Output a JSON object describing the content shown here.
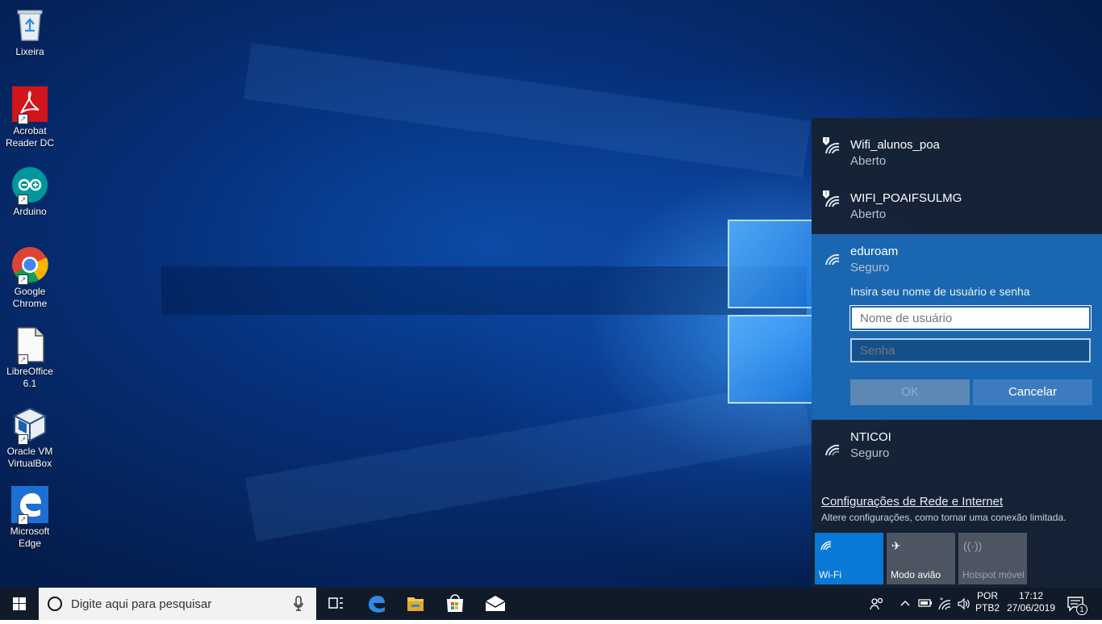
{
  "desktop": {
    "icons": [
      {
        "label": "Lixeira",
        "icon": "recycle-bin-icon"
      },
      {
        "label": "Acrobat Reader DC",
        "icon": "acrobat-icon"
      },
      {
        "label": "Arduino",
        "icon": "arduino-icon"
      },
      {
        "label": "Google Chrome",
        "icon": "chrome-icon"
      },
      {
        "label": "LibreOffice 6.1",
        "icon": "libreoffice-icon"
      },
      {
        "label": "Oracle VM VirtualBox",
        "icon": "virtualbox-icon"
      },
      {
        "label": "Microsoft Edge",
        "icon": "edge-icon"
      }
    ]
  },
  "network_flyout": {
    "networks": [
      {
        "name": "Wifi_alunos_poa",
        "status": "Aberto",
        "secured": false
      },
      {
        "name": "WIFI_POAIFSULMG",
        "status": "Aberto",
        "secured": false
      },
      {
        "name": "eduroam",
        "status": "Seguro",
        "selected": true
      },
      {
        "name": "NTICOI",
        "status": "Seguro"
      }
    ],
    "credential_prompt": "Insira seu nome de usuário e senha",
    "username_placeholder": "Nome de usuário",
    "password_placeholder": "Senha",
    "ok_label": "OK",
    "cancel_label": "Cancelar",
    "settings_link": "Configurações de Rede e Internet",
    "settings_sub": "Altere configurações, como tornar uma conexão limitada.",
    "quick_actions": [
      {
        "label": "Wi-Fi",
        "icon": "wifi-icon",
        "active": true
      },
      {
        "label": "Modo avião",
        "icon": "airplane-icon",
        "active": false
      },
      {
        "label": "Hotspot móvel",
        "icon": "hotspot-icon",
        "active": false,
        "disabled": true
      }
    ]
  },
  "taskbar": {
    "search_placeholder": "Digite aqui para pesquisar",
    "pinned": [
      "task-view-icon",
      "edge-icon",
      "file-explorer-icon",
      "store-icon",
      "mail-icon"
    ],
    "language_line1": "POR",
    "language_line2": "PTB2",
    "time": "17:12",
    "date": "27/06/2019",
    "notification_count": "1"
  },
  "colors": {
    "accent": "#0a78d7",
    "flyout_bg": "#16222f",
    "selected_net": "#1a66b0",
    "taskbar": "#101a28"
  }
}
